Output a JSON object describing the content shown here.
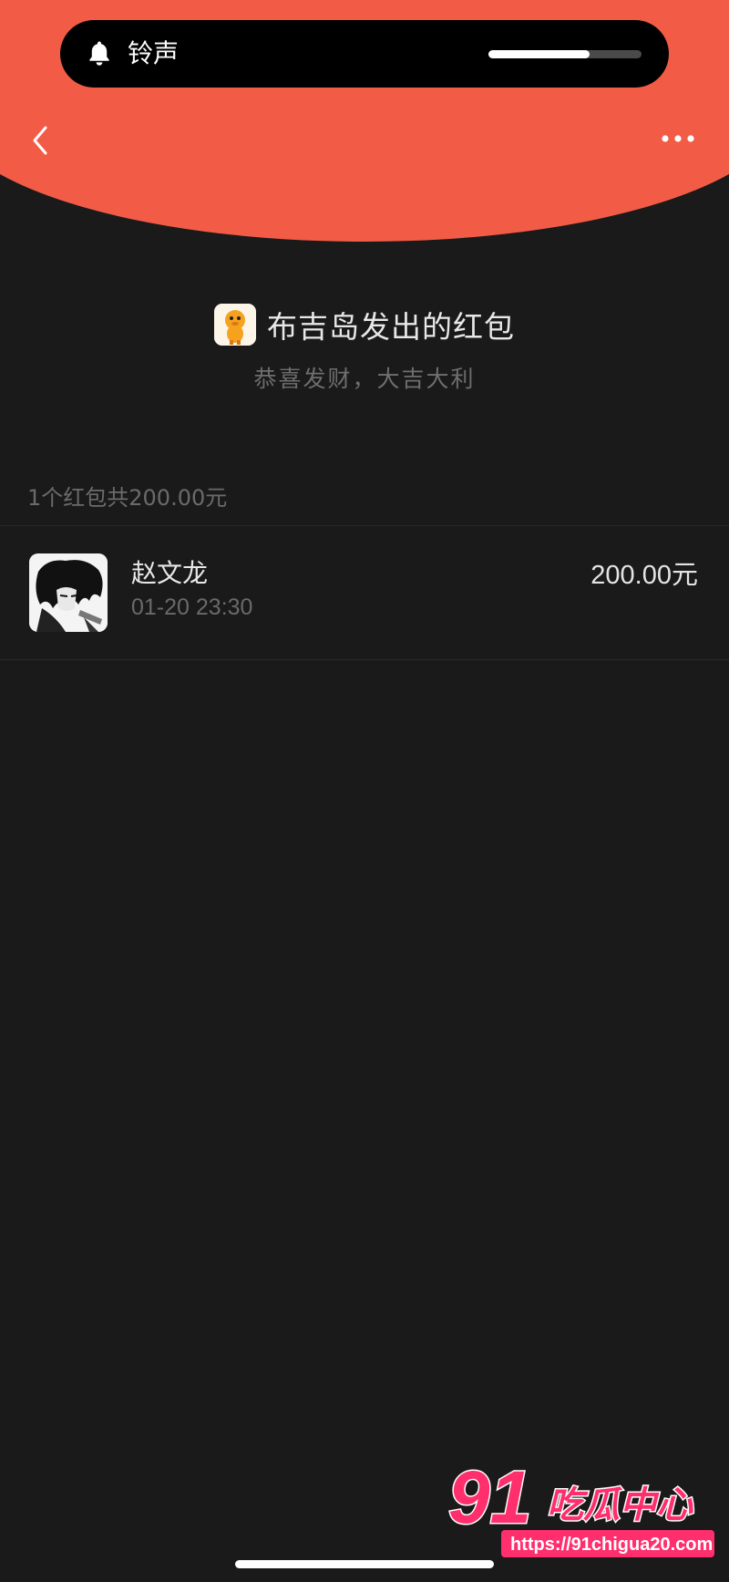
{
  "status": {
    "ringer_label": "铃声",
    "volume_level_pct": 66
  },
  "nav": {
    "back_icon": "chevron-left-icon",
    "more_icon": "more-horizontal-icon"
  },
  "packet": {
    "title": "布吉岛发出的红包",
    "blessing": "恭喜发财，大吉大利",
    "summary": "1个红包共200.00元"
  },
  "records": [
    {
      "name": "赵文龙",
      "time": "01-20 23:30",
      "amount": "200.00元"
    }
  ],
  "watermark": {
    "logo_text": "91吃瓜中心",
    "url": "https://91chigua20.com"
  },
  "colors": {
    "header_red": "#f25c47",
    "background": "#1a1a1a",
    "watermark_pink": "#ff2e6d"
  }
}
